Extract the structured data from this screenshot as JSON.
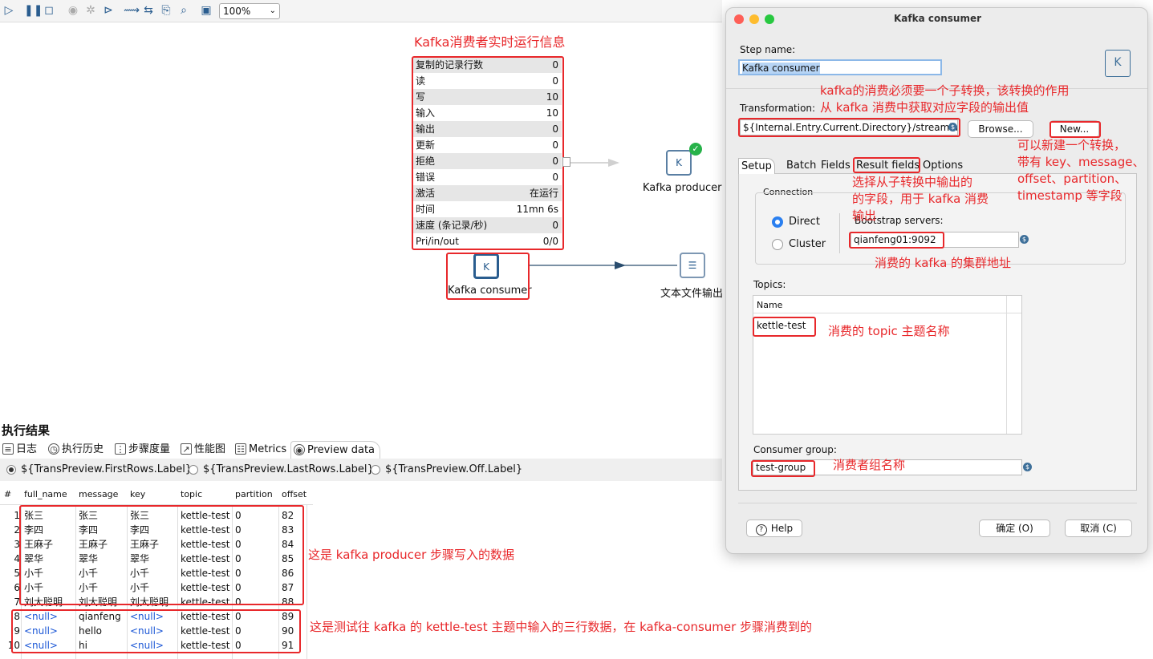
{
  "toolbar": {
    "zoom": "100%"
  },
  "metrics_panel": {
    "title": "Kafka消费者实时运行信息",
    "rows": [
      {
        "key": "复制的记录行数",
        "value": "0"
      },
      {
        "key": "读",
        "value": "0"
      },
      {
        "key": "写",
        "value": "10"
      },
      {
        "key": "输入",
        "value": "10"
      },
      {
        "key": "输出",
        "value": "0"
      },
      {
        "key": "更新",
        "value": "0"
      },
      {
        "key": "拒绝",
        "value": "0"
      },
      {
        "key": "错误",
        "value": "0"
      },
      {
        "key": "激活",
        "value": "在运行"
      },
      {
        "key": "时间",
        "value": "11mn 6s"
      },
      {
        "key": "速度 (条记录/秒)",
        "value": "0"
      },
      {
        "key": "Pri/in/out",
        "value": "0/0"
      }
    ]
  },
  "canvas": {
    "steps": {
      "producer": "Kafka producer",
      "consumer": "Kafka consumer",
      "text_output": "文本文件输出"
    },
    "icon_letter": "K"
  },
  "results": {
    "title": "执行结果",
    "tabs": [
      "日志",
      "执行历史",
      "步骤度量",
      "性能图",
      "Metrics",
      "Preview data"
    ],
    "radios": [
      "${TransPreview.FirstRows.Label}",
      "${TransPreview.LastRows.Label}",
      "${TransPreview.Off.Label}"
    ],
    "columns": [
      "#",
      "full_name",
      "message",
      "key",
      "topic",
      "partition",
      "offset"
    ],
    "rows": [
      [
        "1",
        "张三",
        "张三",
        "张三",
        "kettle-test",
        "0",
        "82"
      ],
      [
        "2",
        "李四",
        "李四",
        "李四",
        "kettle-test",
        "0",
        "83"
      ],
      [
        "3",
        "王麻子",
        "王麻子",
        "王麻子",
        "kettle-test",
        "0",
        "84"
      ],
      [
        "4",
        "翠华",
        "翠华",
        "翠华",
        "kettle-test",
        "0",
        "85"
      ],
      [
        "5",
        "小千",
        "小千",
        "小千",
        "kettle-test",
        "0",
        "86"
      ],
      [
        "6",
        "小千",
        "小千",
        "小千",
        "kettle-test",
        "0",
        "87"
      ],
      [
        "7",
        "刘大聪明",
        "刘大聪明",
        "刘大聪明",
        "kettle-test",
        "0",
        "88"
      ],
      [
        "8",
        "<null>",
        "qianfeng",
        "<null>",
        "kettle-test",
        "0",
        "89"
      ],
      [
        "9",
        "<null>",
        "hello",
        "<null>",
        "kettle-test",
        "0",
        "90"
      ],
      [
        "10",
        "<null>",
        "hi",
        "<null>",
        "kettle-test",
        "0",
        "91"
      ]
    ]
  },
  "dialog": {
    "title": "Kafka consumer",
    "step_name_label": "Step name:",
    "step_name_value": "Kafka consumer",
    "transformation_label": "Transformation:",
    "transformation_value": "${Internal.Entry.Current.Directory}/streaming-",
    "browse_button": "Browse...",
    "new_button": "New...",
    "tabs": [
      "Setup",
      "Batch",
      "Fields",
      "Result fields",
      "Options"
    ],
    "connection_label": "Connection",
    "direct_label": "Direct",
    "cluster_label": "Cluster",
    "bootstrap_label": "Bootstrap servers:",
    "bootstrap_value": "qianfeng01:9092",
    "topics_label": "Topics:",
    "topics_header": "Name",
    "topic_value": "kettle-test",
    "consumer_group_label": "Consumer group:",
    "consumer_group_value": "test-group",
    "help_button": "Help",
    "ok_button": "确定 (O)",
    "cancel_button": "取消 (C)"
  },
  "annotations": {
    "transformation_note_1": "kafka的消费必须要一个子转换，该转换的作用",
    "transformation_note_2": "从 kafka 消费中获取对应字段的输出值",
    "new_note_1": "可以新建一个转换，",
    "new_note_2": "带有 key、message、",
    "new_note_3": "offset、partition、",
    "new_note_4": "timestamp 等字段",
    "result_fields_note_1": "选择从子转换中输出的",
    "result_fields_note_2": "的字段，用于 kafka 消费",
    "result_fields_note_3": "输出",
    "bootstrap_note": "消费的 kafka 的集群地址",
    "topic_note": "消费的 topic 主题名称",
    "group_note": "消费者组名称",
    "producer_rows_note": "这是 kafka producer 步骤写入的数据",
    "consumer_rows_note": "这是测试往 kafka 的 kettle-test 主题中输入的三行数据，在 kafka-consumer 步骤消费到的"
  },
  "colors": {
    "annotation": "#e8282b",
    "accent": "#2a5d8f",
    "null": "#1b57d6",
    "success": "#27b24a"
  }
}
